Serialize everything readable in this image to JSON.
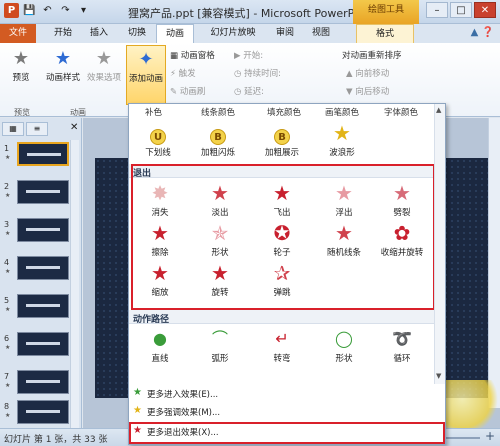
{
  "titlebar": {
    "title": "狸窝产品.ppt [兼容模式] - Microsoft PowerPoint",
    "context_tab": "绘图工具",
    "app_icon_text": "P"
  },
  "tabs": [
    "文件",
    "开始",
    "插入",
    "切换",
    "动画",
    "幻灯片放映",
    "审阅",
    "视图",
    "格式"
  ],
  "ribbon": {
    "preview": "预览",
    "animation_style": "动画样式",
    "effect_options": "效果选项",
    "add_animation": "添加动画",
    "animation_pane": "动画窗格",
    "trigger": "触发",
    "animation_painter": "动画刷",
    "start": "开始:",
    "duration": "持续时间:",
    "delay": "延迟:",
    "reorder": "对动画重新排序",
    "move_earlier": "向前移动",
    "move_later": "向后移动",
    "group_preview": "预览",
    "group_animation": "动画"
  },
  "dropdown": {
    "top_labels": [
      "补色",
      "线条颜色",
      "填充颜色",
      "画笔颜色",
      "字体颜色"
    ],
    "emphasis_items": [
      {
        "label": "下划线",
        "badge": "U"
      },
      {
        "label": "加粗闪烁",
        "badge": "B"
      },
      {
        "label": "加粗展示",
        "badge": "B"
      },
      {
        "label": "波浪形",
        "badge": ""
      }
    ],
    "exit_title": "退出",
    "exit_items": [
      "消失",
      "淡出",
      "飞出",
      "浮出",
      "劈裂",
      "擦除",
      "形状",
      "轮子",
      "随机线条",
      "收缩并旋转",
      "缩放",
      "旋转",
      "弹跳"
    ],
    "path_title": "动作路径",
    "path_items": [
      "直线",
      "弧形",
      "转弯",
      "形状",
      "循环"
    ],
    "menu": [
      "更多进入效果(E)...",
      "更多强调效果(M)...",
      "更多退出效果(X)..."
    ]
  },
  "slides": [
    "1",
    "2",
    "3",
    "4",
    "5",
    "6",
    "7",
    "8"
  ],
  "status": {
    "text": "幻灯片 第 1 张，共 33 张"
  },
  "colors": {
    "accent_red": "#d9202a",
    "file_tab": "#d35b22",
    "star_red": "#c8202e",
    "context_tab": "#e9a425"
  }
}
